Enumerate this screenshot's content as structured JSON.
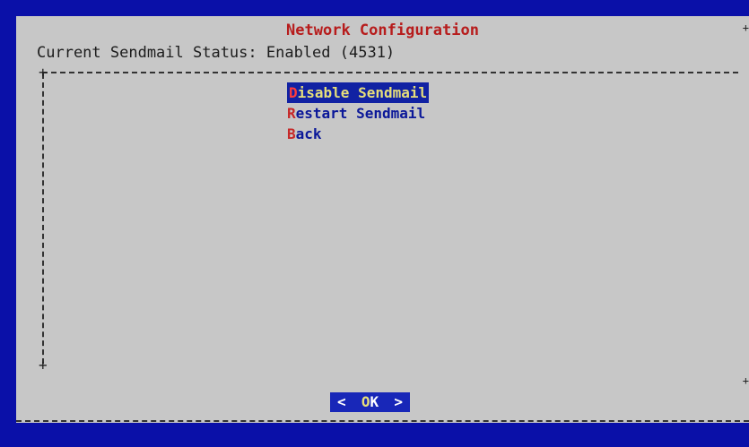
{
  "dialog": {
    "title": "Network Configuration",
    "status_text": "Current Sendmail Status: Enabled (4531)"
  },
  "menu": {
    "items": [
      {
        "hotkey": "D",
        "rest": "isable Sendmail",
        "selected": true
      },
      {
        "hotkey": "R",
        "rest": "estart Sendmail",
        "selected": false
      },
      {
        "hotkey": "B",
        "rest": "ack",
        "selected": false
      }
    ]
  },
  "buttons": {
    "ok_left": "<",
    "ok_hot": "O",
    "ok_rest": "K",
    "ok_right": ">"
  },
  "colors": {
    "background": "#0a10a8",
    "dialog": "#c7c7c7",
    "title": "#b71c1c",
    "menu_text": "#0b1899",
    "selected_bg": "#1122a3",
    "selected_fg": "#e7df7a",
    "hotkey": "#c62828"
  }
}
